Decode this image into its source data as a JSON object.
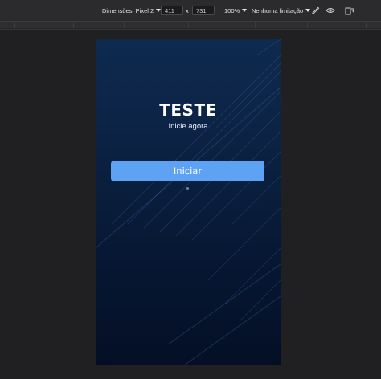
{
  "devtools": {
    "dimensions_label": "Dimensões: Pixel 2",
    "width_value": "411",
    "separator": "x",
    "height_value": "731",
    "zoom": "100%",
    "throttle": "Nenhuma limitação",
    "icons": [
      "eyedropper-icon",
      "eye-icon",
      "rotate-icon"
    ]
  },
  "app": {
    "title": "TESTE",
    "subtitle": "Inicie agora",
    "button_label": "Iniciar",
    "colors": {
      "background_top": "#0f2a4f",
      "background_bottom": "#040f25",
      "button": "#5ea2f4"
    }
  }
}
